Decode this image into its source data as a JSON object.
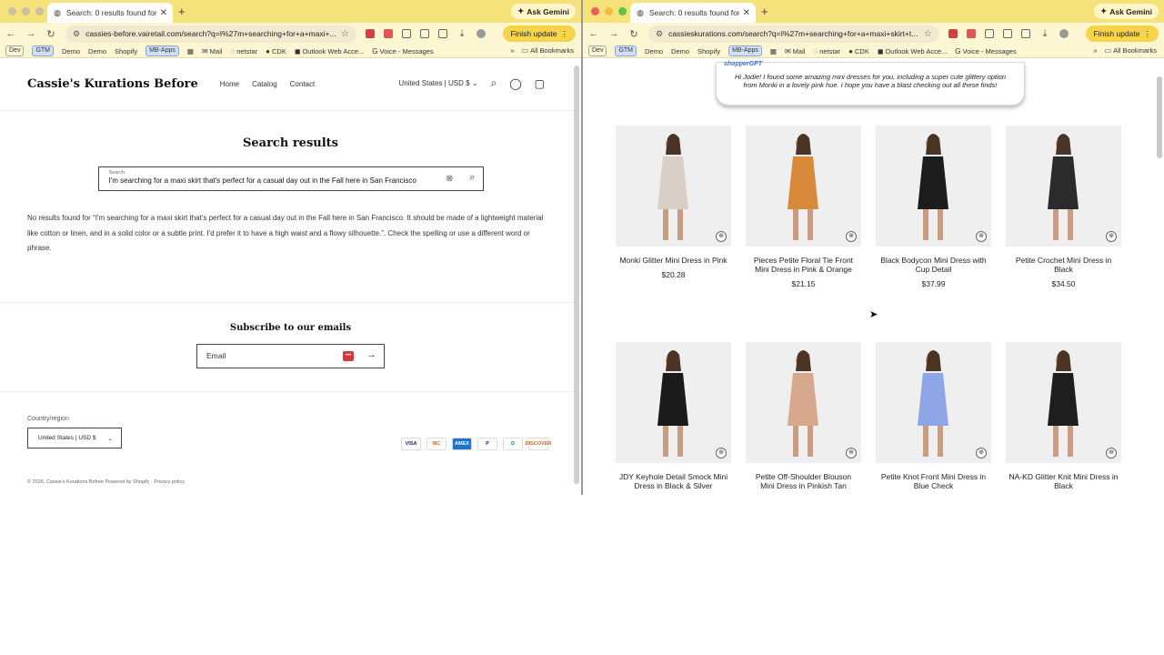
{
  "left": {
    "tab_title": "Search: 0 results found for \"I'",
    "url": "cassies-before.vairetail.com/search?q=I%27m+searching+for+a+maxi+...",
    "ask_gemini": "Ask Gemini",
    "finish_update": "Finish update",
    "bookmarks": [
      "Dev",
      "GTM",
      "Demo",
      "Demo",
      "Shopify",
      "MB-Apps"
    ],
    "bookmarks_links": [
      "Mail",
      "netstar",
      "CDK",
      "Outlook Web Acce...",
      "Voice - Messages"
    ],
    "bookmarks_more": "»",
    "all_bookmarks": "All Bookmarks",
    "store": {
      "brand": "Cassie's Kurations Before",
      "nav": [
        "Home",
        "Catalog",
        "Contact"
      ],
      "currency": "United States | USD $",
      "search_title": "Search results",
      "search_label": "Search",
      "search_value": "I'm searching for a maxi skirt that's perfect for a casual day out in the Fall here in San Francisco",
      "no_results": "No results found for “I'm searching for a maxi skirt that's perfect for a casual day out in the Fall here in San Francisco. It should be made of a lightweight material like cotton or linen, and in a solid color or a subtle print. I'd prefer it to have a high waist and a flowy silhouette.”. Check the spelling or use a different word or phrase.",
      "subscribe_title": "Subscribe to our emails",
      "email_placeholder": "Email",
      "country_label": "Country/region",
      "country_value": "United States | USD $",
      "payments": [
        "VISA",
        "MC",
        "AMEX",
        "P",
        "D",
        "DISCOVER"
      ],
      "copyright": "© 2026, Cassie's Kurations Before Powered by Shopify",
      "privacy": "Privacy policy"
    }
  },
  "right": {
    "tab_title": "Search: 0 results found for \"I'",
    "url": "cassieskurations.com/search?q=I%27m+searching+for+a+maxi+skirt+t...",
    "ask_gemini": "Ask Gemini",
    "finish_update": "Finish update",
    "bookmarks": [
      "Dev",
      "GTM",
      "Demo",
      "Demo",
      "Shopify",
      "MB-Apps"
    ],
    "bookmarks_links": [
      "Mail",
      "netstar",
      "CDK",
      "Outlook Web Acce...",
      "Voice - Messages"
    ],
    "bookmarks_more": "»",
    "all_bookmarks": "All Bookmarks",
    "assistant": {
      "logo": "shopperGPT",
      "message": "Hi Jodie! I found some amazing mini dresses for you, including a super cute glittery option from Monki in a lovely pink hue. I hope you have a blast checking out all these finds!"
    },
    "products": [
      {
        "name": "Monki Glitter Mini Dress in Pink",
        "price": "$20.28",
        "color": "#d9cfc6"
      },
      {
        "name": "Pieces Petite Floral Tie Front Mini Dress in Pink & Orange",
        "price": "$21.15",
        "color": "#d88a3a"
      },
      {
        "name": "Black Bodycon Mini Dress with Cup Detail",
        "price": "$37.99",
        "color": "#1c1c1c"
      },
      {
        "name": "Petite Crochet Mini Dress in Black",
        "price": "$34.50",
        "color": "#2b2b2b"
      },
      {
        "name": "JDY Keyhole Detail Smock Mini Dress in Black & Silver",
        "price": "",
        "color": "#1a1a1a"
      },
      {
        "name": "Petite Off-Shoulder Blouson Mini Dress in Pinkish Tan",
        "price": "",
        "color": "#d8a88e"
      },
      {
        "name": "Petite Knot Front Mini Dress in Blue Check",
        "price": "",
        "color": "#8ea6e6"
      },
      {
        "name": "NA-KD Glitter Knit Mini Dress in Black",
        "price": "",
        "color": "#1e1e1e"
      }
    ]
  }
}
